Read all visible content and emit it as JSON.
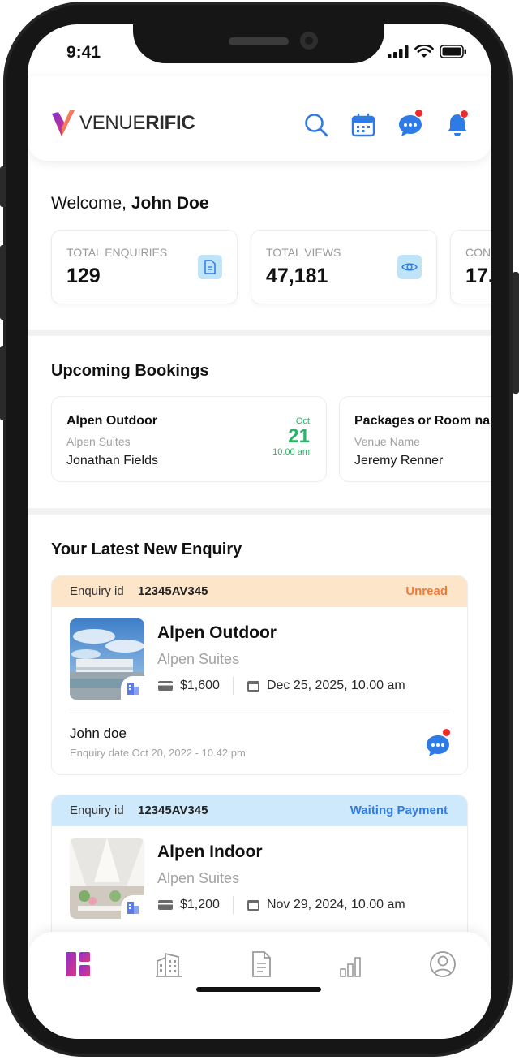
{
  "status_bar": {
    "time": "9:41"
  },
  "brand": {
    "name_light": "VENUE",
    "name_bold": "RIFIC"
  },
  "header": {
    "icons": [
      "search-icon",
      "calendar-icon",
      "chat-icon",
      "bell-icon"
    ]
  },
  "welcome": {
    "greeting": "Welcome,",
    "user": "John Doe"
  },
  "stats": [
    {
      "label": "TOTAL ENQUIRIES",
      "value": "129",
      "icon": "document-icon"
    },
    {
      "label": "TOTAL VIEWS",
      "value": "47,181",
      "icon": "eye-icon"
    },
    {
      "label": "CON",
      "value": "17."
    }
  ],
  "upcoming": {
    "title": "Upcoming Bookings",
    "items": [
      {
        "venue": "Alpen Outdoor",
        "sub": "Alpen Suites",
        "person": "Jonathan Fields",
        "month": "Oct",
        "day": "21",
        "time": "10.00 am"
      },
      {
        "venue": "Packages or Room nam",
        "sub": "Venue Name",
        "person": "Jeremy Renner"
      }
    ]
  },
  "latest": {
    "title": "Your Latest New Enquiry",
    "items": [
      {
        "id_label": "Enquiry id",
        "id": "12345AV345",
        "status": "Unread",
        "status_color": "#f07a3a",
        "head_bg": "#fde5c9",
        "venue": "Alpen Outdoor",
        "sub": "Alpen Suites",
        "price": "$1,600",
        "date": "Dec 25, 2025, 10.00 am",
        "name": "John doe",
        "enquiry_date": "Enquiry date Oct 20, 2022 - 10.42 pm"
      },
      {
        "id_label": "Enquiry id",
        "id": "12345AV345",
        "status": "Waiting Payment",
        "status_color": "#2f7be6",
        "head_bg": "#cde9fb",
        "venue": "Alpen Indoor",
        "sub": "Alpen Suites",
        "price": "$1,200",
        "date": "Nov 29, 2024, 10.00 am"
      }
    ]
  },
  "nav": {
    "items": [
      "dashboard-icon",
      "building-icon",
      "document-icon",
      "chart-icon",
      "profile-icon"
    ],
    "active": "dashboard-icon"
  },
  "colors": {
    "brand_purple": "#9b2fc9",
    "blue": "#2f7be6",
    "green": "#2cb36a"
  }
}
